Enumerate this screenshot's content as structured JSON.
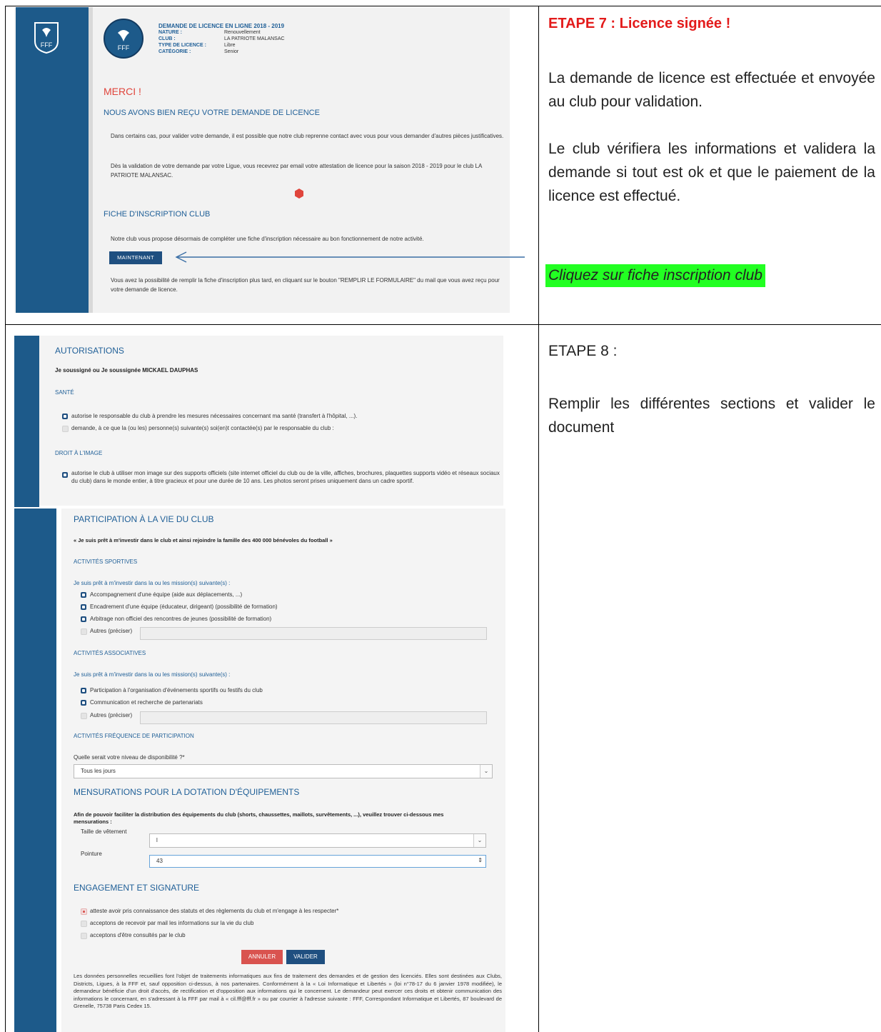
{
  "step7": {
    "title": "ETAPE 7 :  Licence signée !",
    "p1": "La demande de licence est effectuée et envoyée au club pour validation.",
    "p2": "Le club vérifiera les informations et validera la demande si tout est ok et que le paiement de la licence est effectué.",
    "highlight": "Cliquez sur fiche inscription club",
    "highlight_color": "#22ff22",
    "title_color": "#e31b1b"
  },
  "step8": {
    "title": "ETAPE 8 :",
    "p1": "Remplir les différentes sections et valider le document"
  },
  "shot1": {
    "logo_text": "FFF",
    "header_title": "DEMANDE DE LICENCE EN LIGNE 2018 - 2019",
    "fields": [
      {
        "label": "NATURE :",
        "value": "Renouvellement"
      },
      {
        "label": "CLUB :",
        "value": "LA PATRIOTE MALANSAC"
      },
      {
        "label": "TYPE DE LICENCE :",
        "value": "Libre"
      },
      {
        "label": "CATÉGORIE :",
        "value": "Senior"
      }
    ],
    "merci": "MERCI !",
    "received": "NOUS AVONS BIEN REÇU VOTRE DEMANDE DE LICENCE",
    "para1": "Dans certains cas, pour valider votre demande, il est possible que notre club reprenne contact avec vous pour vous demander d'autres pièces justificatives.",
    "para2": "Dès la validation de votre demande par votre Ligue, vous recevrez par email votre attestation de licence pour la saison 2018 - 2019 pour le club LA PATRIOTE MALANSAC.",
    "fiche_title": "FICHE D'INSCRIPTION CLUB",
    "fiche_text": "Notre club vous propose désormais de compléter une fiche d'inscription nécessaire au bon fonctionnement de notre activité.",
    "button": "MAINTENANT",
    "later": "Vous avez la possibilité de remplir la fiche d'inscription plus tard, en cliquant sur le bouton \"REMPLIR LE FORMULAIRE\" du mail que vous avez reçu pour votre demande de licence."
  },
  "shot2": {
    "title": "AUTORISATIONS",
    "signer": "Je soussigné ou Je soussignée MICKAEL DAUPHAS",
    "sante": "SANTÉ",
    "sante1": "autorise le responsable du club à prendre les mesures nécessaires concernant ma santé (transfert à l'hôpital, ...).",
    "sante2": "demande, à ce que la (ou les) personne(s) suivante(s) soi(en)t contactée(s) par le responsable du club :",
    "droit": "DROIT À L'IMAGE",
    "droit1": "autorise le club à utiliser mon image sur des supports officiels (site internet officiel du club ou de la ville, affiches, brochures, plaquettes supports vidéo et réseaux sociaux du club) dans le monde entier, à titre gracieux et pour une durée de 10 ans. Les photos seront prises uniquement dans un cadre sportif."
  },
  "shot3": {
    "title": "PARTICIPATION À LA VIE DU CLUB",
    "quote": "« Je suis prêt à m'investir dans le club et ainsi rejoindre la famille des 400 000 bénévoles du football »",
    "sport_title": "ACTIVITÉS SPORTIVES",
    "sport_lead": "Je suis prêt à m'investir dans la ou les mission(s) suivante(s) :",
    "sport_items": [
      "Accompagnement d'une équipe (aide aux déplacements, ...)",
      "Encadrement d'une équipe (éducateur, dirigeant) (possibilité de formation)",
      "Arbitrage non officiel des rencontres de jeunes (possibilité de formation)",
      "Autres (préciser)"
    ],
    "asso_title": "ACTIVITÉS ASSOCIATIVES",
    "asso_lead": "Je suis prêt à m'investir dans la ou les mission(s) suivante(s) :",
    "asso_items": [
      "Participation à l'organisation d'événements sportifs ou festifs du club",
      "Communication et recherche de partenariats",
      "Autres (préciser)"
    ],
    "freq_title": "ACTIVITÉS FRÉQUENCE DE PARTICIPATION",
    "freq_q": "Quelle serait votre niveau de disponibilité ?*",
    "freq_value": "Tous les jours",
    "mens_title": "MENSURATIONS POUR LA DOTATION D'ÉQUIPEMENTS",
    "mens_text": "Afin de pouvoir faciliter la distribution des équipements du club (shorts, chaussettes, maillots, survêtements, ...), veuillez trouver ci-dessous mes mensurations :",
    "taille_label": "Taille de vêtement",
    "taille_value": "l",
    "pointure_label": "Pointure",
    "pointure_value": "43",
    "eng_title": "ENGAGEMENT ET SIGNATURE",
    "eng_items": [
      "atteste avoir pris connaissance des statuts et des règlements du club et m'engage à les respecter*",
      "acceptons de recevoir par mail les informations sur la vie du club",
      "acceptons d'être consultés par le club"
    ],
    "annuler": "ANNULER",
    "valider": "VALIDER",
    "legal": "Les données personnelles recueillies font l'objet de traitements informatiques aux fins de traitement des demandes et de gestion des licenciés. Elles sont destinées aux Clubs, Districts, Ligues, à la FFF et, sauf opposition ci-dessus, à nos partenaires. Conformément à la « Loi Informatique et Libertés » (loi n°78-17 du 6 janvier 1978 modifiée), le demandeur bénéficie d'un droit d'accès, de rectification et d'opposition aux informations qui le concernent. Le demandeur peut exercer ces droits et obtenir communication des informations le concernant, en s'adressant à la FFF par mail à « cil.fff@fff.fr » ou par courrier à l'adresse suivante : FFF, Correspondant Informatique et Libertés, 87 boulevard de Grenelle, 75738 Paris Cedex 15."
  }
}
